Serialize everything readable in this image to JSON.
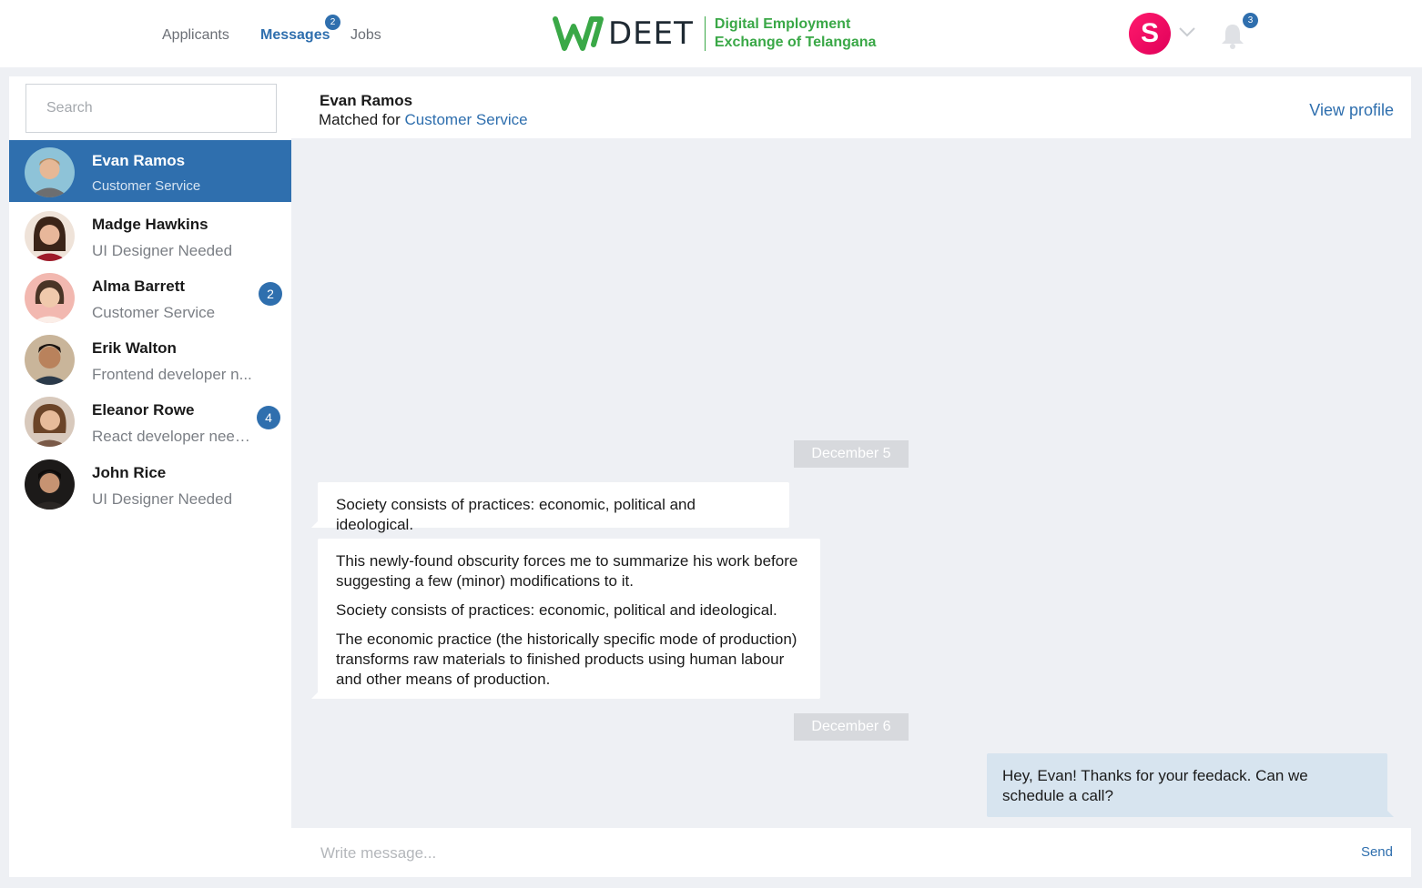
{
  "header": {
    "nav": [
      {
        "label": "Applicants"
      },
      {
        "label": "Messages",
        "badge": "2"
      },
      {
        "label": "Jobs"
      }
    ],
    "logo": {
      "wordmark": "DEET",
      "tagline_line1": "Digital Employment",
      "tagline_line2": "Exchange of Telangana"
    },
    "user_avatar_letter": "S",
    "notification_count": "3",
    "icons": [
      "logo-mark-icon",
      "chevron-down-icon",
      "bell-icon"
    ]
  },
  "sidebar": {
    "search_placeholder": "Search",
    "contacts": [
      {
        "name": "Evan Ramos",
        "job": "Customer Service",
        "selected": true,
        "avatar_color": "#8ec3d8"
      },
      {
        "name": "Madge Hawkins",
        "job": "UI Designer Needed",
        "avatar_color": "#d9a48a"
      },
      {
        "name": "Alma Barrett",
        "job": "Customer Service",
        "badge": "2",
        "avatar_color": "#f2b8b0"
      },
      {
        "name": "Erik Walton",
        "job": "Frontend developer n...",
        "avatar_color": "#c9a27d"
      },
      {
        "name": "Eleanor Rowe",
        "job": "React developer need...",
        "badge": "4",
        "avatar_color": "#c79a7c"
      },
      {
        "name": "John Rice",
        "job": "UI Designer Needed",
        "avatar_color": "#3a2a22"
      }
    ]
  },
  "chat": {
    "name": "Evan Ramos",
    "matched_prefix": "Matched for",
    "matched_role": "Customer Service",
    "view_profile": "View profile",
    "dates": [
      "December 5",
      "December 6"
    ],
    "messages": [
      {
        "direction": "in",
        "paragraphs": [
          "Society consists of practices: economic, political and ideological."
        ]
      },
      {
        "direction": "in",
        "paragraphs": [
          "This newly-found obscurity forces me to summarize his work before suggesting a few (minor) modifications to it.",
          "Society consists of practices: economic, political and ideological.",
          "The economic practice (the historically specific mode of production) transforms raw materials to finished products using human labour and other means of production."
        ]
      },
      {
        "direction": "out",
        "paragraphs": [
          "Hey, Evan! Thanks for your feedack. Can we schedule a call?"
        ]
      }
    ]
  },
  "composer": {
    "placeholder": "Write message...",
    "send_label": "Send"
  },
  "colors": {
    "accent": "#2f6fae",
    "brand_green": "#3aa847",
    "background": "#eef0f4",
    "outgoing_bubble": "#d7e4ef",
    "avatar_pink": "#ff1a6c"
  }
}
